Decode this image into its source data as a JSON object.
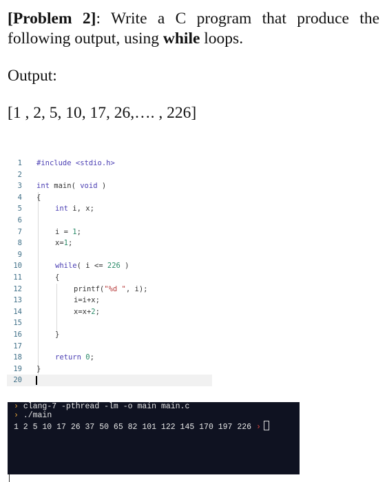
{
  "problem": {
    "label": "[Problem 2]",
    "text_before_bold": ": Write a C program that produce the following output, using ",
    "bold_word": "while",
    "text_after_bold": " loops."
  },
  "output_label": "Output:",
  "sequence": "[1 , 2, 5, 10, 17, 26,…. , 226]",
  "editor": {
    "lines": [
      {
        "n": "1"
      },
      {
        "n": "2"
      },
      {
        "n": "3"
      },
      {
        "n": "4"
      },
      {
        "n": "5"
      },
      {
        "n": "6"
      },
      {
        "n": "7"
      },
      {
        "n": "8"
      },
      {
        "n": "9"
      },
      {
        "n": "10"
      },
      {
        "n": "11"
      },
      {
        "n": "12"
      },
      {
        "n": "13"
      },
      {
        "n": "14"
      },
      {
        "n": "15"
      },
      {
        "n": "16"
      },
      {
        "n": "17"
      },
      {
        "n": "18"
      },
      {
        "n": "19"
      },
      {
        "n": "20"
      }
    ],
    "code": {
      "l1_inc": "#include <stdio.h>",
      "l3_type": "int",
      "l3_rest": " main( ",
      "l3_void": "void",
      "l3_end": " )",
      "l4": "{",
      "l5_type": "int",
      "l5_rest": " i, x;",
      "l7_a": "i = ",
      "l7_num": "1",
      "l7_b": ";",
      "l8_a": "x=",
      "l8_num": "1",
      "l8_b": ";",
      "l10_kw": "while",
      "l10_a": "( i <= ",
      "l10_num": "226",
      "l10_b": " )",
      "l11": "{",
      "l12_a": "printf(",
      "l12_str": "\"%d \"",
      "l12_b": ", i);",
      "l13": "i=i+x;",
      "l14_a": "x=x+",
      "l14_num": "2",
      "l14_b": ";",
      "l16": "}",
      "l18_kw": "return",
      "l18_sp": " ",
      "l18_num": "0",
      "l18_b": ";",
      "l19": "}"
    }
  },
  "terminal": {
    "prompt_symbol": "›",
    "cmd1": "clang-7 -pthread -lm -o main main.c",
    "cmd2": "./main",
    "output": "1 2 5 10 17 26 37 50 65 82 101 122 145 170 197 226"
  }
}
